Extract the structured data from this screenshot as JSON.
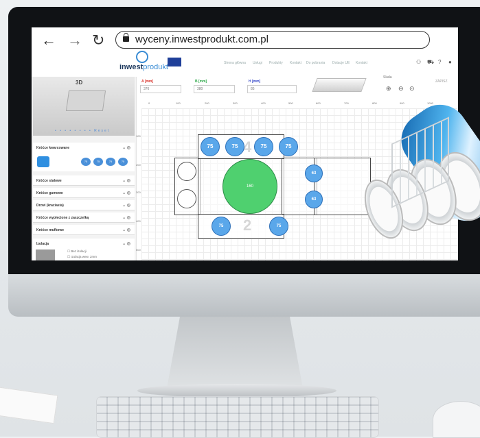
{
  "browser": {
    "url": "wyceny.inwestprodukt.com.pl",
    "back_icon": "←",
    "forward_icon": "→",
    "reload_icon": "↻"
  },
  "site": {
    "logo_bold": "inwest",
    "logo_light": "produkt",
    "menu": [
      "Strona główna",
      "Usługi",
      "Produkty",
      "Kontakt",
      "Do pobrania",
      "Dotacje UE",
      "Kontakt"
    ],
    "header_icons": [
      "user-icon",
      "cart-icon",
      "help-icon",
      "settings-icon"
    ]
  },
  "left_panel": {
    "preview_title": "3D",
    "carousel": "• • • • • • • • Reset",
    "sections": [
      {
        "title": "Króćce kwarcowane",
        "chips": [
          "75",
          "75",
          "75",
          "75"
        ]
      },
      {
        "title": "Króćce stalowe"
      },
      {
        "title": "Króćce gumowe"
      },
      {
        "title": "Drzwi (kraciasta)"
      },
      {
        "title": "Króćce wyplecione z zaszczelką"
      },
      {
        "title": "Króćce mufkowe"
      }
    ],
    "insulation": {
      "title": "Izolacja",
      "options": [
        "Bez izolacji",
        "Izolacja wew. 2mm"
      ]
    }
  },
  "dimensions": {
    "a": {
      "label": "A [mm]",
      "value": "376",
      "color": "#d9332b"
    },
    "b": {
      "label": "B [mm]",
      "value": "380",
      "color": "#2ea84a"
    },
    "h": {
      "label": "H [mm]",
      "value": "85",
      "color": "#3245c8"
    }
  },
  "zoom": {
    "label": "Skala",
    "icons": [
      "zoom-in-icon",
      "zoom-out-icon",
      "zoom-reset-icon"
    ],
    "save": "ZAPISZ"
  },
  "ruler_x": [
    "0",
    "100",
    "200",
    "300",
    "400",
    "500",
    "600",
    "700",
    "800",
    "900",
    "1000"
  ],
  "ruler_y": [
    "100",
    "200",
    "300",
    "400",
    "500"
  ],
  "drawing": {
    "top_circles": [
      "75",
      "75",
      "75",
      "75"
    ],
    "right_circles": [
      "63",
      "63"
    ],
    "bottom_circles": [
      "75",
      "75"
    ],
    "center": "160",
    "side_top_label": "4",
    "side_bottom_label": "2",
    "center_color": "#4fd06f",
    "circle_color": "#5aa7ea"
  }
}
